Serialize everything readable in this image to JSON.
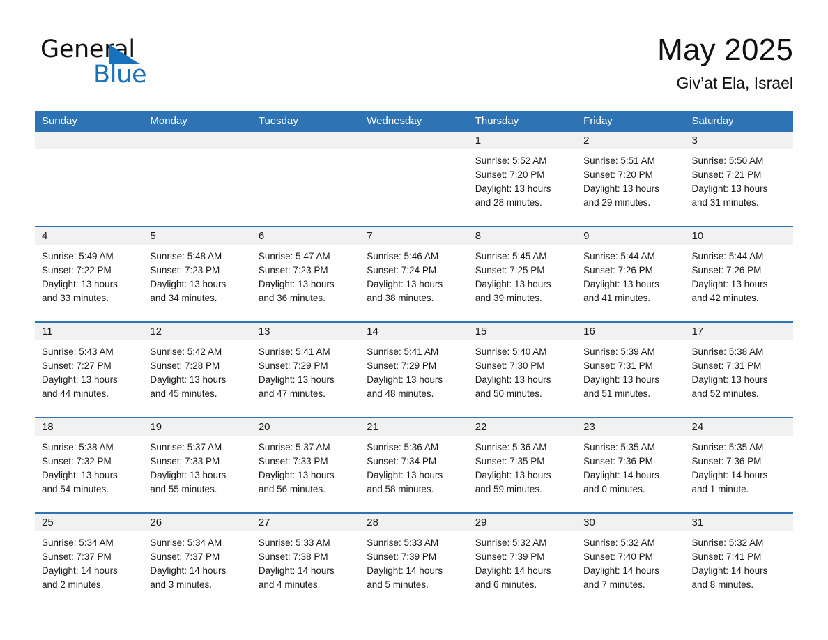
{
  "brand": {
    "name_part1": "General",
    "name_part2": "Blue",
    "triangle_color": "#1771bb",
    "accent_color": "#2e74b5"
  },
  "header": {
    "month_title": "May 2025",
    "location": "Giv’at Ela, Israel"
  },
  "calendar": {
    "weekday_headers": [
      "Sunday",
      "Monday",
      "Tuesday",
      "Wednesday",
      "Thursday",
      "Friday",
      "Saturday"
    ],
    "header_bg": "#2e74b5",
    "daynum_band_bg": "#f1f1f1",
    "weeks": [
      [
        {
          "day": "",
          "lines": []
        },
        {
          "day": "",
          "lines": []
        },
        {
          "day": "",
          "lines": []
        },
        {
          "day": "",
          "lines": []
        },
        {
          "day": "1",
          "lines": [
            "Sunrise: 5:52 AM",
            "Sunset: 7:20 PM",
            "Daylight: 13 hours",
            "and 28 minutes."
          ]
        },
        {
          "day": "2",
          "lines": [
            "Sunrise: 5:51 AM",
            "Sunset: 7:20 PM",
            "Daylight: 13 hours",
            "and 29 minutes."
          ]
        },
        {
          "day": "3",
          "lines": [
            "Sunrise: 5:50 AM",
            "Sunset: 7:21 PM",
            "Daylight: 13 hours",
            "and 31 minutes."
          ]
        }
      ],
      [
        {
          "day": "4",
          "lines": [
            "Sunrise: 5:49 AM",
            "Sunset: 7:22 PM",
            "Daylight: 13 hours",
            "and 33 minutes."
          ]
        },
        {
          "day": "5",
          "lines": [
            "Sunrise: 5:48 AM",
            "Sunset: 7:23 PM",
            "Daylight: 13 hours",
            "and 34 minutes."
          ]
        },
        {
          "day": "6",
          "lines": [
            "Sunrise: 5:47 AM",
            "Sunset: 7:23 PM",
            "Daylight: 13 hours",
            "and 36 minutes."
          ]
        },
        {
          "day": "7",
          "lines": [
            "Sunrise: 5:46 AM",
            "Sunset: 7:24 PM",
            "Daylight: 13 hours",
            "and 38 minutes."
          ]
        },
        {
          "day": "8",
          "lines": [
            "Sunrise: 5:45 AM",
            "Sunset: 7:25 PM",
            "Daylight: 13 hours",
            "and 39 minutes."
          ]
        },
        {
          "day": "9",
          "lines": [
            "Sunrise: 5:44 AM",
            "Sunset: 7:26 PM",
            "Daylight: 13 hours",
            "and 41 minutes."
          ]
        },
        {
          "day": "10",
          "lines": [
            "Sunrise: 5:44 AM",
            "Sunset: 7:26 PM",
            "Daylight: 13 hours",
            "and 42 minutes."
          ]
        }
      ],
      [
        {
          "day": "11",
          "lines": [
            "Sunrise: 5:43 AM",
            "Sunset: 7:27 PM",
            "Daylight: 13 hours",
            "and 44 minutes."
          ]
        },
        {
          "day": "12",
          "lines": [
            "Sunrise: 5:42 AM",
            "Sunset: 7:28 PM",
            "Daylight: 13 hours",
            "and 45 minutes."
          ]
        },
        {
          "day": "13",
          "lines": [
            "Sunrise: 5:41 AM",
            "Sunset: 7:29 PM",
            "Daylight: 13 hours",
            "and 47 minutes."
          ]
        },
        {
          "day": "14",
          "lines": [
            "Sunrise: 5:41 AM",
            "Sunset: 7:29 PM",
            "Daylight: 13 hours",
            "and 48 minutes."
          ]
        },
        {
          "day": "15",
          "lines": [
            "Sunrise: 5:40 AM",
            "Sunset: 7:30 PM",
            "Daylight: 13 hours",
            "and 50 minutes."
          ]
        },
        {
          "day": "16",
          "lines": [
            "Sunrise: 5:39 AM",
            "Sunset: 7:31 PM",
            "Daylight: 13 hours",
            "and 51 minutes."
          ]
        },
        {
          "day": "17",
          "lines": [
            "Sunrise: 5:38 AM",
            "Sunset: 7:31 PM",
            "Daylight: 13 hours",
            "and 52 minutes."
          ]
        }
      ],
      [
        {
          "day": "18",
          "lines": [
            "Sunrise: 5:38 AM",
            "Sunset: 7:32 PM",
            "Daylight: 13 hours",
            "and 54 minutes."
          ]
        },
        {
          "day": "19",
          "lines": [
            "Sunrise: 5:37 AM",
            "Sunset: 7:33 PM",
            "Daylight: 13 hours",
            "and 55 minutes."
          ]
        },
        {
          "day": "20",
          "lines": [
            "Sunrise: 5:37 AM",
            "Sunset: 7:33 PM",
            "Daylight: 13 hours",
            "and 56 minutes."
          ]
        },
        {
          "day": "21",
          "lines": [
            "Sunrise: 5:36 AM",
            "Sunset: 7:34 PM",
            "Daylight: 13 hours",
            "and 58 minutes."
          ]
        },
        {
          "day": "22",
          "lines": [
            "Sunrise: 5:36 AM",
            "Sunset: 7:35 PM",
            "Daylight: 13 hours",
            "and 59 minutes."
          ]
        },
        {
          "day": "23",
          "lines": [
            "Sunrise: 5:35 AM",
            "Sunset: 7:36 PM",
            "Daylight: 14 hours",
            "and 0 minutes."
          ]
        },
        {
          "day": "24",
          "lines": [
            "Sunrise: 5:35 AM",
            "Sunset: 7:36 PM",
            "Daylight: 14 hours",
            "and 1 minute."
          ]
        }
      ],
      [
        {
          "day": "25",
          "lines": [
            "Sunrise: 5:34 AM",
            "Sunset: 7:37 PM",
            "Daylight: 14 hours",
            "and 2 minutes."
          ]
        },
        {
          "day": "26",
          "lines": [
            "Sunrise: 5:34 AM",
            "Sunset: 7:37 PM",
            "Daylight: 14 hours",
            "and 3 minutes."
          ]
        },
        {
          "day": "27",
          "lines": [
            "Sunrise: 5:33 AM",
            "Sunset: 7:38 PM",
            "Daylight: 14 hours",
            "and 4 minutes."
          ]
        },
        {
          "day": "28",
          "lines": [
            "Sunrise: 5:33 AM",
            "Sunset: 7:39 PM",
            "Daylight: 14 hours",
            "and 5 minutes."
          ]
        },
        {
          "day": "29",
          "lines": [
            "Sunrise: 5:32 AM",
            "Sunset: 7:39 PM",
            "Daylight: 14 hours",
            "and 6 minutes."
          ]
        },
        {
          "day": "30",
          "lines": [
            "Sunrise: 5:32 AM",
            "Sunset: 7:40 PM",
            "Daylight: 14 hours",
            "and 7 minutes."
          ]
        },
        {
          "day": "31",
          "lines": [
            "Sunrise: 5:32 AM",
            "Sunset: 7:41 PM",
            "Daylight: 14 hours",
            "and 8 minutes."
          ]
        }
      ]
    ]
  }
}
